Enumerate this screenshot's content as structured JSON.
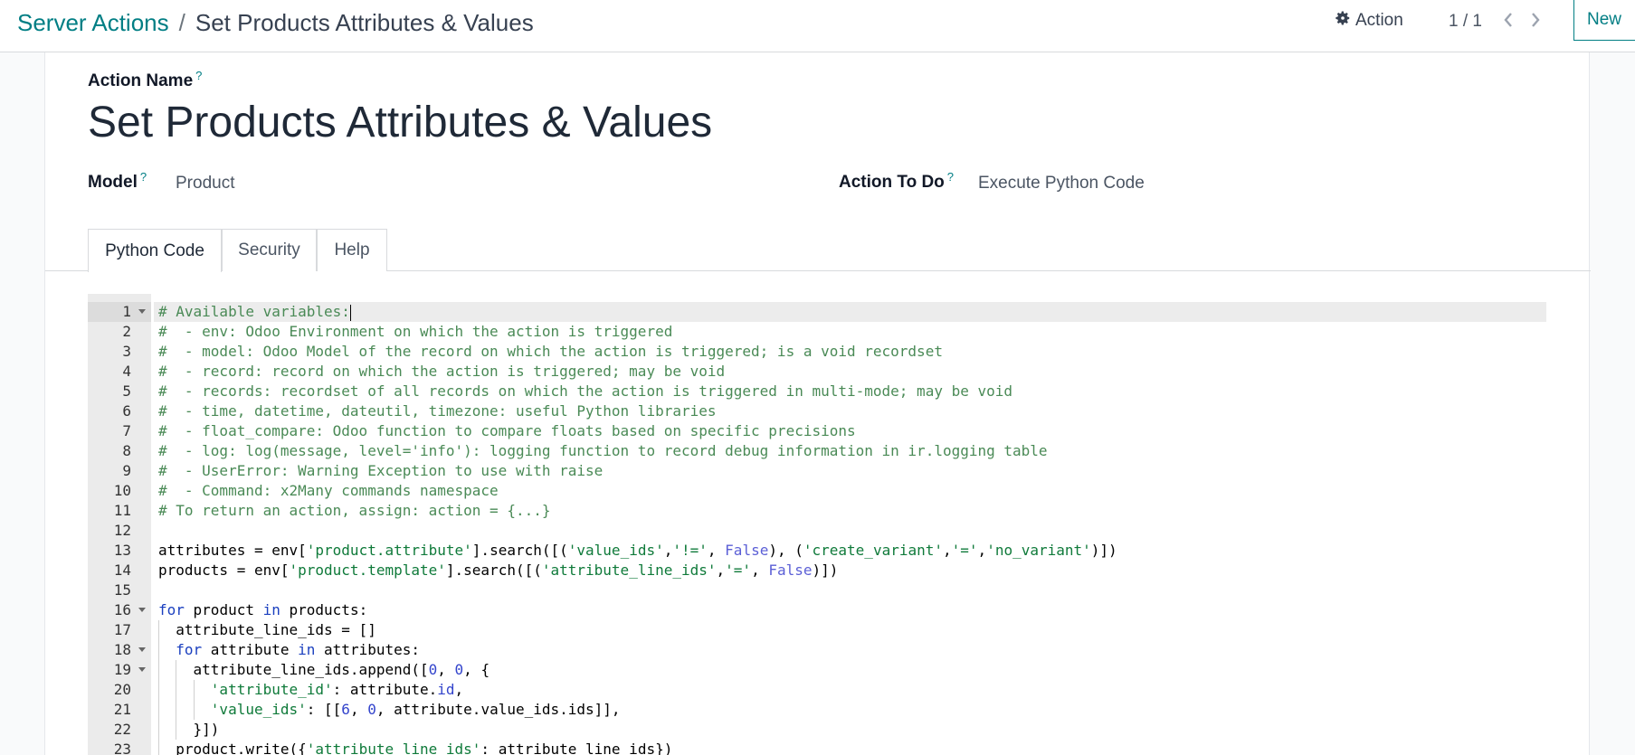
{
  "breadcrumb": {
    "parent": "Server Actions",
    "separator": "/",
    "current": "Set Products Attributes & Values"
  },
  "toolbar": {
    "action_label": "Action",
    "pager": "1 / 1",
    "new_label": "New"
  },
  "form": {
    "action_name_label": "Action Name",
    "action_name_value": "Set Products Attributes & Values",
    "model_label": "Model",
    "model_value": "Product",
    "action_to_do_label": "Action To Do",
    "action_to_do_value": "Execute Python Code",
    "help_mark": "?"
  },
  "tabs": [
    {
      "label": "Python Code",
      "active": true
    },
    {
      "label": "Security",
      "active": false
    },
    {
      "label": "Help",
      "active": false
    }
  ],
  "code": {
    "lines": [
      "# Available variables:",
      "#  - env: Odoo Environment on which the action is triggered",
      "#  - model: Odoo Model of the record on which the action is triggered; is a void recordset",
      "#  - record: record on which the action is triggered; may be void",
      "#  - records: recordset of all records on which the action is triggered in multi-mode; may be void",
      "#  - time, datetime, dateutil, timezone: useful Python libraries",
      "#  - float_compare: Odoo function to compare floats based on specific precisions",
      "#  - log: log(message, level='info'): logging function to record debug information in ir.logging table",
      "#  - UserError: Warning Exception to use with raise",
      "#  - Command: x2Many commands namespace",
      "# To return an action, assign: action = {...}",
      "",
      "attributes = env['product.attribute'].search([('value_ids','!=', False), ('create_variant','=','no_variant')])",
      "products = env['product.template'].search([('attribute_line_ids','=', False)])",
      "",
      "for product in products:",
      "  attribute_line_ids = []",
      "  for attribute in attributes:",
      "    attribute_line_ids.append([0, 0, {",
      "      'attribute_id': attribute.id,",
      "      'value_ids': [[6, 0, attribute.value_ids.ids]],",
      "    }])",
      "  product.write({'attribute_line_ids': attribute_line_ids})"
    ],
    "line_numbers": [
      "1",
      "2",
      "3",
      "4",
      "5",
      "6",
      "7",
      "8",
      "9",
      "10",
      "11",
      "12",
      "13",
      "14",
      "15",
      "16",
      "17",
      "18",
      "19",
      "20",
      "21",
      "22",
      "23"
    ],
    "fold_lines": [
      1,
      16,
      18,
      19
    ],
    "active_line": 1
  },
  "colors": {
    "accent": "#017e84",
    "comment": "#4a8a56",
    "string": "#0f7a3a",
    "keyword": "#1a3fbf"
  },
  "icons": {
    "action": "gear-icon",
    "pager_prev": "chevron-left-icon",
    "pager_next": "chevron-right-icon",
    "fold": "fold-arrow-icon"
  }
}
